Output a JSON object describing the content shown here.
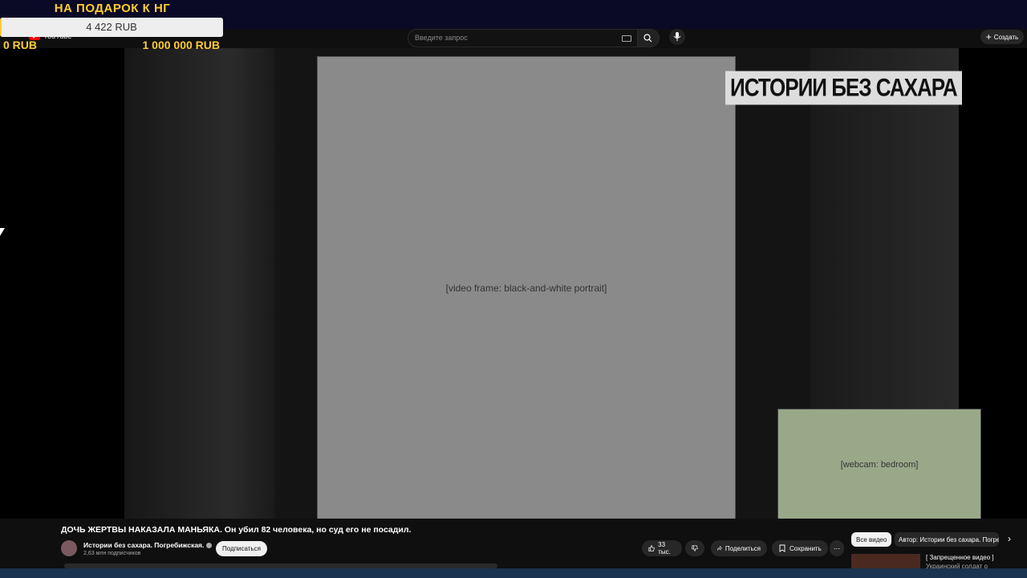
{
  "donation": {
    "title": "НА ПОДАРОК К НГ",
    "current": "4 422 RUB",
    "min": "0 RUB",
    "max": "1 000 000 RUB",
    "progress_fraction": 0.0044
  },
  "header": {
    "logo_text": "YouTube",
    "search_placeholder": "Введите запрос",
    "create_label": "Создать"
  },
  "video": {
    "banner_text": "ИСТОРИИ БЕЗ САХАРА",
    "frame_placeholder": "[video frame: black-and-white portrait]",
    "webcam_placeholder": "[webcam: bedroom]"
  },
  "info": {
    "title": "ДОЧЬ ЖЕРТВЫ НАКАЗАЛА МАНЬЯКА. Он убил 82 человека, но суд его не посадил.",
    "channel": "Истории без сахара. Погребижская.",
    "subscribers": "2,63 млн подписчиков",
    "subscribe_label": "Подписаться",
    "likes": "33 тыс.",
    "share_label": "Поделиться",
    "save_label": "Сохранить"
  },
  "recommendations": {
    "chip_all": "Все видео",
    "chip_author": "Автор: Истории без сахара. Погребижская.",
    "item_title": "[ Запрещенное видео ]",
    "item_sub": "Украинский солдат о"
  },
  "colors": {
    "accent_yellow": "#ffcc33",
    "yt_red": "#ff0000",
    "background": "#0f0f0f"
  }
}
